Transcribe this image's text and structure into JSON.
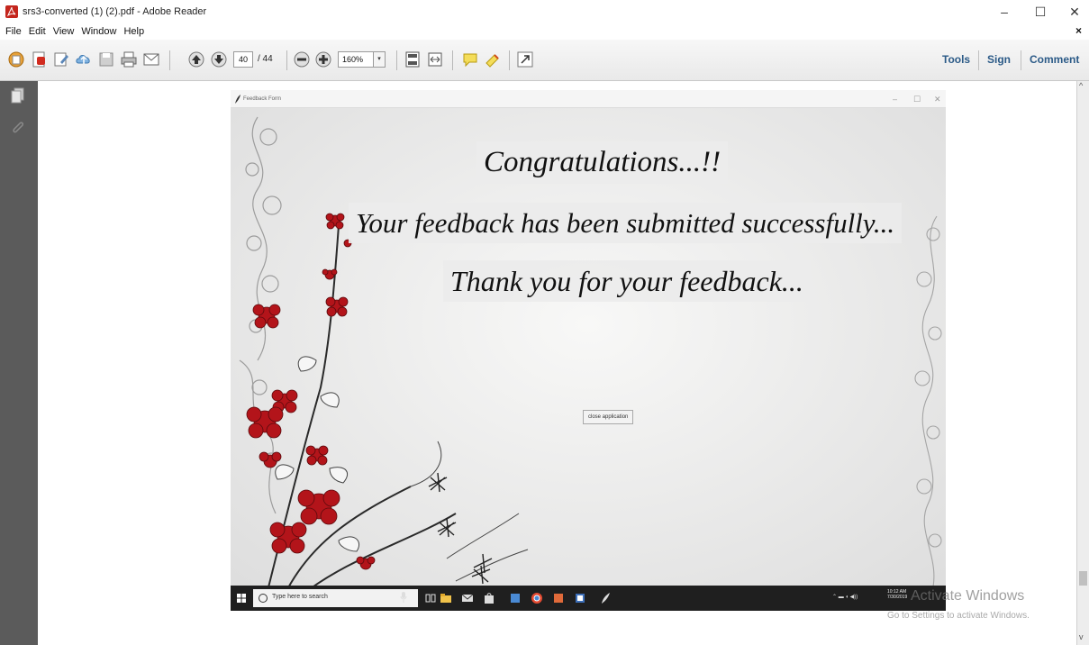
{
  "window": {
    "title": "srs3-converted (1) (2).pdf - Adobe Reader",
    "minimize": "–",
    "maximize": "☐",
    "close": "✕"
  },
  "menubar": {
    "items": [
      "File",
      "Edit",
      "View",
      "Window",
      "Help"
    ],
    "close": "×"
  },
  "toolbar": {
    "page_current": "40",
    "page_total": "/ 44",
    "zoom": "160%",
    "zoom_arrow": "▾",
    "tools": "Tools",
    "sign": "Sign",
    "comment": "Comment"
  },
  "scrollbar": {
    "up": "^",
    "down": "v"
  },
  "feedback_app": {
    "title": "Feedback Form",
    "minimize": "–",
    "maximize": "☐",
    "close": "✕",
    "line1": "Congratulations...!!",
    "line2": "Your feedback has been submitted successfully...",
    "line3": "Thank you for your feedback...",
    "close_button": "close application"
  },
  "taskbar": {
    "search_placeholder": "Type here to search",
    "tray": "⌃ ▬ ◖ ◀))",
    "time": "10:12 AM",
    "date": "7/30/2019"
  },
  "watermark": {
    "line1": "Activate Windows",
    "line2": "Go to Settings to activate Windows."
  },
  "colors": {
    "link": "#2b5a87",
    "nav_panel": "#5b5b5b",
    "flower_red": "#b3141a",
    "taskbar": "#1f1f1f"
  }
}
